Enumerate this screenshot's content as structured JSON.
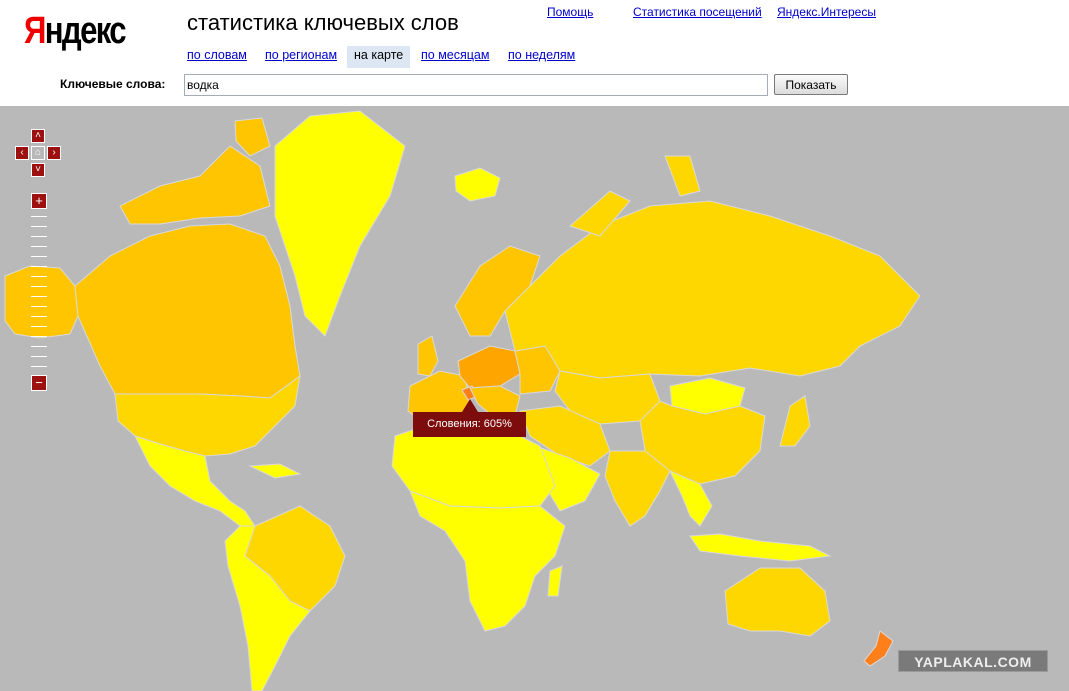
{
  "header": {
    "logo": {
      "first": "Я",
      "rest": "ндекс"
    },
    "title": "статистика ключевых слов",
    "links": [
      "Помощь",
      "Статистика посещений",
      "Яндекс.Интересы"
    ],
    "tabs": [
      {
        "label": "по словам",
        "active": false
      },
      {
        "label": "по регионам",
        "active": false
      },
      {
        "label": "на карте",
        "active": true
      },
      {
        "label": "по месяцам",
        "active": false
      },
      {
        "label": "по неделям",
        "active": false
      }
    ]
  },
  "search": {
    "label": "Ключевые слова:",
    "value": "водка",
    "button": "Показать"
  },
  "map": {
    "nav": {
      "up": "˄",
      "down": "˅",
      "left": "‹",
      "right": "›",
      "home": "⌂"
    },
    "zoom": {
      "in": "+",
      "out": "−"
    },
    "tooltip": "Словения: 605%",
    "colors": {
      "ocean": "#b9b9b9",
      "lowest": "#ffff00",
      "low": "#ffed00",
      "medium": "#ffd700",
      "high": "#ffc500",
      "higher": "#ffa500",
      "highest": "#ff7f1a",
      "border": "#d9d9d9"
    }
  },
  "watermark": "YAPLAKAL.COM"
}
